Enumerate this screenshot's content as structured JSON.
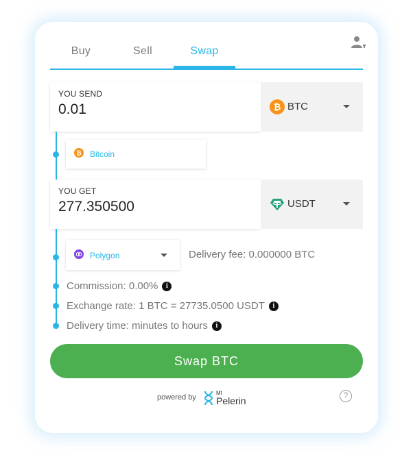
{
  "tabs": [
    {
      "label": "Buy"
    },
    {
      "label": "Sell"
    },
    {
      "label": "Swap"
    }
  ],
  "active_tab": "Swap",
  "send": {
    "label": "YOU SEND",
    "amount": "0.01",
    "coin": "BTC",
    "network": "Bitcoin"
  },
  "get": {
    "label": "YOU GET",
    "amount": "277.350500",
    "coin": "USDT",
    "network": "Polygon"
  },
  "delivery_fee": "Delivery fee: 0.000000 BTC",
  "commission": "Commission: 0.00%",
  "exchange_rate": "Exchange rate: 1 BTC = 27735.0500 USDT",
  "delivery_time": "Delivery time: minutes to hours",
  "swap_button": "Swap BTC",
  "footer": {
    "powered_by": "powered by",
    "brand_small": "Mt",
    "brand_big": "Pelerin"
  },
  "icons": {
    "user": "user-settings-icon",
    "btc": "bitcoin-icon",
    "usdt": "tether-icon",
    "polygon": "polygon-icon",
    "info": "info-icon",
    "help": "help-icon"
  },
  "colors": {
    "accent": "#29b6e6",
    "button": "#4caf50",
    "btc": "#f7931a",
    "usdt": "#26a17b",
    "polygon": "#8247e5"
  }
}
